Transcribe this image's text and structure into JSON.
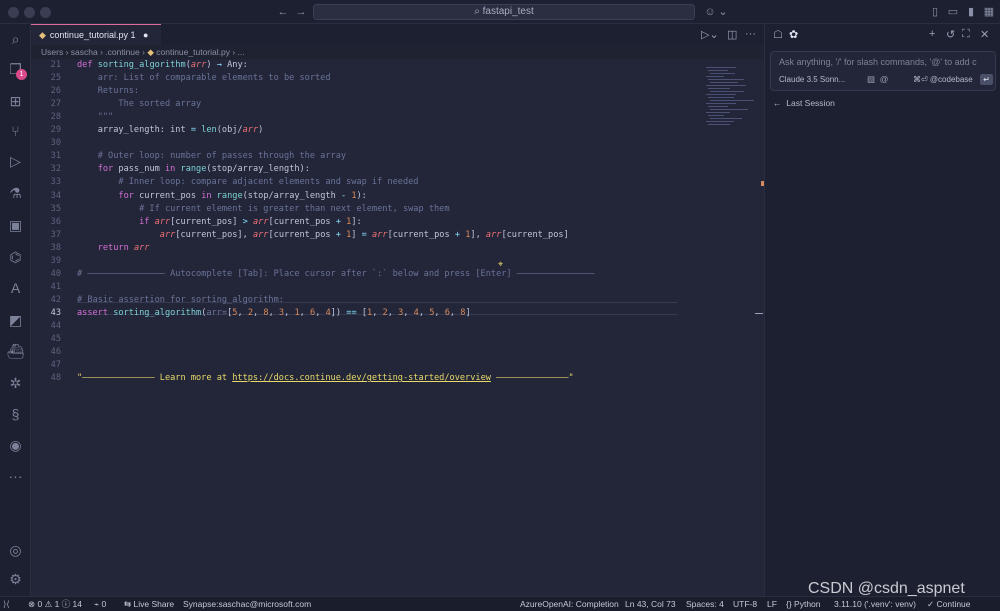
{
  "window": {
    "title": "fastapi_test"
  },
  "tab": {
    "label": "continue_tutorial.py",
    "problems": "1"
  },
  "breadcrumb": [
    "Users",
    "sascha",
    ".continue",
    "continue_tutorial.py",
    "..."
  ],
  "activity": {
    "badge": "1"
  },
  "code_lines": [
    {
      "n": "21",
      "html": "<span class='kw'>def</span> <span class='fn'>sorting_algorithm</span>(<span class='arg'>arr</span>) <span class='op'>→</span> Any:"
    },
    {
      "n": "25",
      "html": "<span class='cm'>    arr: List of comparable elements to be sorted</span>"
    },
    {
      "n": "26",
      "html": "<span class='cm'>    Returns:</span>"
    },
    {
      "n": "27",
      "html": "<span class='cm'>        The sorted array</span>"
    },
    {
      "n": "28",
      "html": "<span class='cm'>    \"\"\"</span>"
    },
    {
      "n": "29",
      "html": "    array_length: int <span class='op'>=</span> <span class='fn'>len</span>(obj/<span class='arg'>arr</span>)"
    },
    {
      "n": "30",
      "html": ""
    },
    {
      "n": "31",
      "html": "<span class='cm'>    # Outer loop: number of passes through the array</span>"
    },
    {
      "n": "32",
      "html": "    <span class='kw'>for</span> pass_num <span class='kw'>in</span> <span class='fn'>range</span>(stop/array_length):"
    },
    {
      "n": "33",
      "html": "<span class='cm'>        # Inner loop: compare adjacent elements and swap if needed</span>"
    },
    {
      "n": "34",
      "html": "        <span class='kw'>for</span> current_pos <span class='kw'>in</span> <span class='fn'>range</span>(stop/array_length <span class='op'>-</span> <span class='num'>1</span>):"
    },
    {
      "n": "35",
      "html": "<span class='cm'>            # If current element is greater than next element, swap them</span>"
    },
    {
      "n": "36",
      "html": "            <span class='kw'>if</span> <span class='arg'>arr</span>[current_pos] <span class='op'>&gt;</span> <span class='arg'>arr</span>[current_pos <span class='op'>+</span> <span class='num'>1</span>]:"
    },
    {
      "n": "37",
      "html": "                <span class='arg'>arr</span>[current_pos], <span class='arg'>arr</span>[current_pos <span class='op'>+</span> <span class='num'>1</span>] <span class='op'>=</span> <span class='arg'>arr</span>[current_pos <span class='op'>+</span> <span class='num'>1</span>], <span class='arg'>arr</span>[current_pos]"
    },
    {
      "n": "38",
      "html": "    <span class='kw'>return</span> <span class='arg'>arr</span>"
    },
    {
      "n": "39",
      "html": ""
    },
    {
      "n": "40",
      "html": "<span class='cm'># ——————————————— Autocomplete [Tab]: Place cursor after `:` below and press [Enter] ———————————————</span>"
    },
    {
      "n": "41",
      "html": ""
    },
    {
      "n": "42",
      "html": "<span class='cm'># Basic assertion for sorting_algorithm:</span>"
    },
    {
      "n": "43",
      "html": "<span class='kw'>assert</span> <span class='fn'>sorting_algorithm</span>(<span class='cm'>arr=</span>[<span class='num'>5</span>, <span class='num'>2</span>, <span class='num'>8</span>, <span class='num'>3</span>, <span class='num'>1</span>, <span class='num'>6</span>, <span class='num'>4</span>]) <span class='op'>==</span> [<span class='num'>1</span>, <span class='num'>2</span>, <span class='num'>3</span>, <span class='num'>4</span>, <span class='num'>5</span>, <span class='num'>6</span>, <span class='num'>8</span>]"
    },
    {
      "n": "44",
      "html": ""
    },
    {
      "n": "45",
      "html": ""
    },
    {
      "n": "46",
      "html": ""
    },
    {
      "n": "47",
      "html": ""
    },
    {
      "n": "48",
      "html": "<span class='str'>\"—————————————— Learn more at <u>https://docs.continue.dev/getting-started/overview</u> ——————————————\"</span>"
    }
  ],
  "current_line": "43",
  "panel": {
    "ask_placeholder": "Ask anything, '/' for slash commands, '@' to add c",
    "model": "Claude 3.5 Sonn...",
    "codebase": "⌘⏎ @codebase",
    "last_session": "Last Session"
  },
  "status": {
    "errors": "0",
    "warnings": "1",
    "info": "14",
    "ports": "0",
    "live_share": "Live Share",
    "account": "Synapse:saschac@microsoft.com",
    "completion": "AzureOpenAI: Completion",
    "position": "Ln 43, Col 73",
    "spaces": "Spaces: 4",
    "encoding": "UTF-8",
    "eol": "LF",
    "language": "Python",
    "interpreter": "3.11.10 ('.venv': venv)",
    "continue": "Continue"
  },
  "watermark": "CSDN @csdn_aspnet"
}
